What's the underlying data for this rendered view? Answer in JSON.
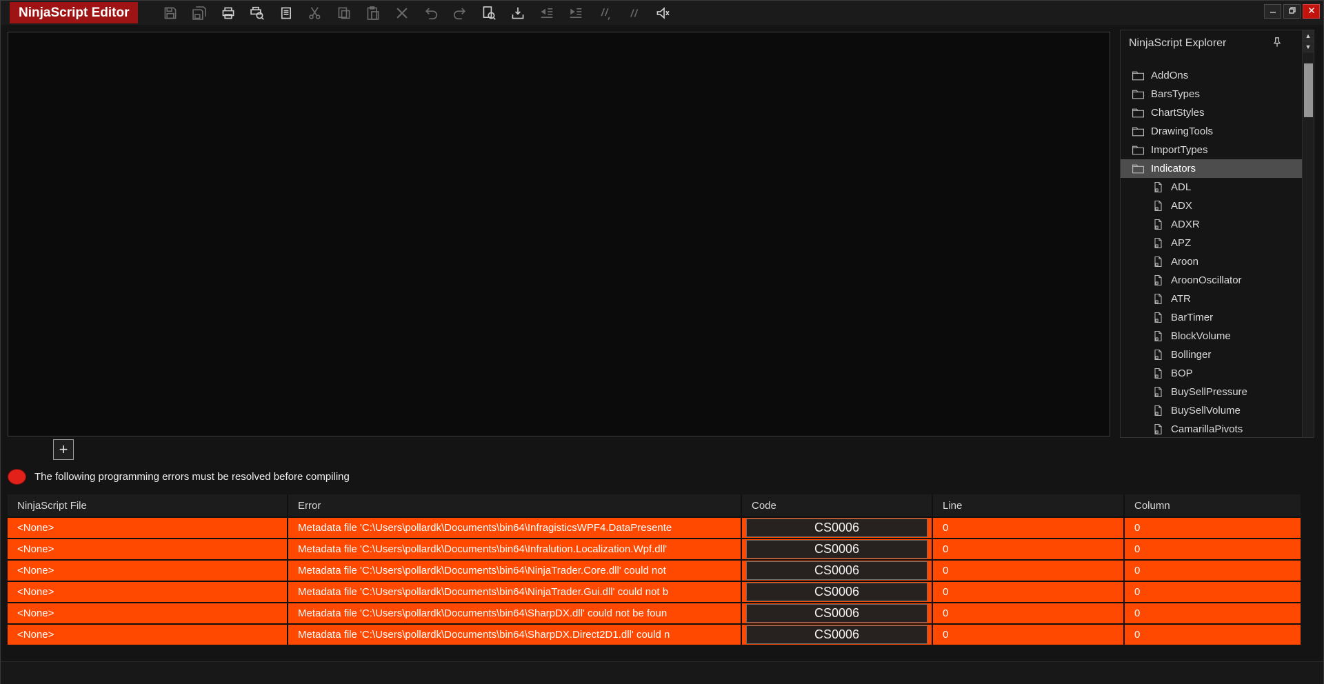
{
  "window": {
    "title": "NinjaScript Editor"
  },
  "toolbar": {
    "icons": [
      {
        "name": "save-icon",
        "enabled": false
      },
      {
        "name": "save-all-icon",
        "enabled": false
      },
      {
        "name": "print-icon",
        "enabled": true
      },
      {
        "name": "print-preview-icon",
        "enabled": true
      },
      {
        "name": "document-icon",
        "enabled": true
      },
      {
        "name": "cut-icon",
        "enabled": false
      },
      {
        "name": "copy-icon",
        "enabled": false
      },
      {
        "name": "paste-icon",
        "enabled": false
      },
      {
        "name": "delete-icon",
        "enabled": false
      },
      {
        "name": "undo-icon",
        "enabled": false
      },
      {
        "name": "redo-icon",
        "enabled": false
      },
      {
        "name": "find-icon",
        "enabled": true
      },
      {
        "name": "import-icon",
        "enabled": true
      },
      {
        "name": "outdent-icon",
        "enabled": false
      },
      {
        "name": "indent-icon",
        "enabled": false
      },
      {
        "name": "comment-icon",
        "enabled": false
      },
      {
        "name": "uncomment-icon",
        "enabled": false
      },
      {
        "name": "speaker-mute-icon",
        "enabled": true
      }
    ]
  },
  "icons": {
    "scroll_up": "▲",
    "scroll_down": "▼"
  },
  "tabs": {
    "add_label": "+"
  },
  "explorer": {
    "title": "NinjaScript Explorer",
    "folders": [
      "AddOns",
      "BarsTypes",
      "ChartStyles",
      "DrawingTools",
      "ImportTypes",
      "Indicators"
    ],
    "selected_folder": "Indicators",
    "files": [
      "ADL",
      "ADX",
      "ADXR",
      "APZ",
      "Aroon",
      "AroonOscillator",
      "ATR",
      "BarTimer",
      "BlockVolume",
      "Bollinger",
      "BOP",
      "BuySellPressure",
      "BuySellVolume",
      "CamarillaPivots"
    ]
  },
  "errors": {
    "banner": "The following programming errors must be resolved before compiling",
    "columns": [
      "NinjaScript File",
      "Error",
      "Code",
      "Line",
      "Column"
    ],
    "rows": [
      {
        "file": "<None>",
        "error": "Metadata file 'C:\\Users\\pollardk\\Documents\\bin64\\InfragisticsWPF4.DataPresente",
        "code": "CS0006",
        "line": "0",
        "column": "0"
      },
      {
        "file": "<None>",
        "error": "Metadata file 'C:\\Users\\pollardk\\Documents\\bin64\\Infralution.Localization.Wpf.dll'",
        "code": "CS0006",
        "line": "0",
        "column": "0"
      },
      {
        "file": "<None>",
        "error": "Metadata file 'C:\\Users\\pollardk\\Documents\\bin64\\NinjaTrader.Core.dll' could not",
        "code": "CS0006",
        "line": "0",
        "column": "0"
      },
      {
        "file": "<None>",
        "error": "Metadata file 'C:\\Users\\pollardk\\Documents\\bin64\\NinjaTrader.Gui.dll' could not b",
        "code": "CS0006",
        "line": "0",
        "column": "0"
      },
      {
        "file": "<None>",
        "error": "Metadata file 'C:\\Users\\pollardk\\Documents\\bin64\\SharpDX.dll' could not be foun",
        "code": "CS0006",
        "line": "0",
        "column": "0"
      },
      {
        "file": "<None>",
        "error": "Metadata file 'C:\\Users\\pollardk\\Documents\\bin64\\SharpDX.Direct2D1.dll' could n",
        "code": "CS0006",
        "line": "0",
        "column": "0"
      }
    ]
  },
  "colors": {
    "error_row": "#ff4800",
    "title_badge": "#9e1414",
    "banner_dot": "#e2211a"
  }
}
